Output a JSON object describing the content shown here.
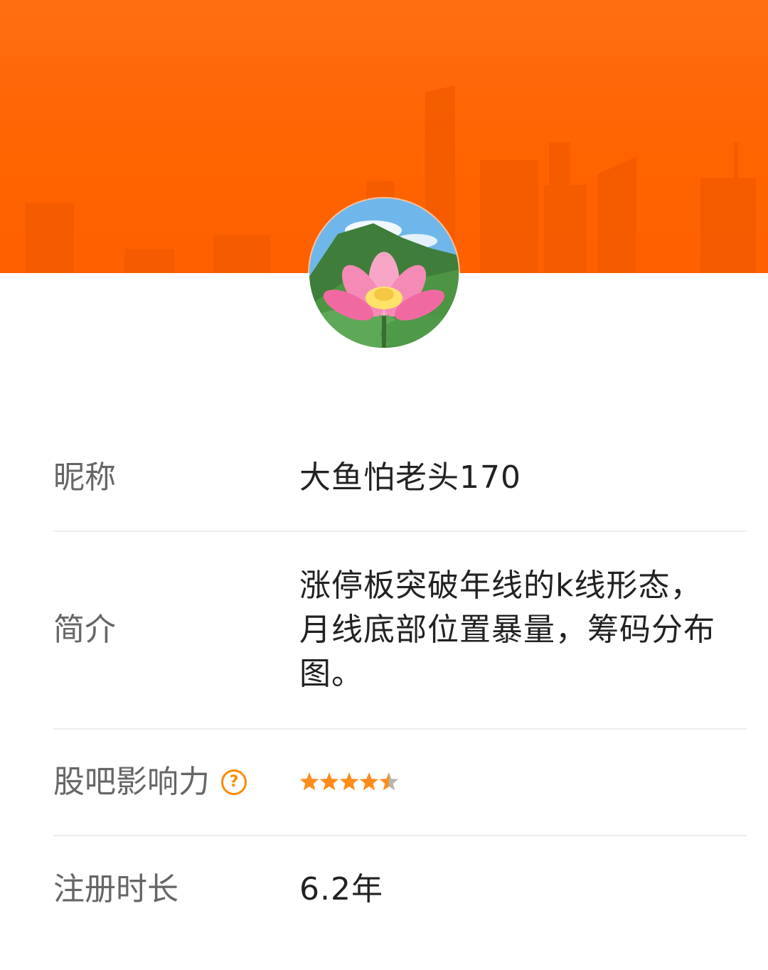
{
  "profile": {
    "nickname_label": "昵称",
    "nickname": "大鱼怕老头170",
    "bio_label": "简介",
    "bio": "涨停板突破年线的k线形态，月线底部位置暴量，筹码分布图。",
    "influence_label": "股吧影响力",
    "influence_help_icon": "question-circle-icon",
    "influence_help_glyph": "?",
    "influence_rating": 4.5,
    "influence_max": 5,
    "duration_label": "注册时长",
    "duration": "6.2年"
  },
  "colors": {
    "banner": "#ff6400",
    "star_filled": "#ff8c1a",
    "star_empty": "#b5b5b5",
    "help_icon": "#ff8a00"
  }
}
